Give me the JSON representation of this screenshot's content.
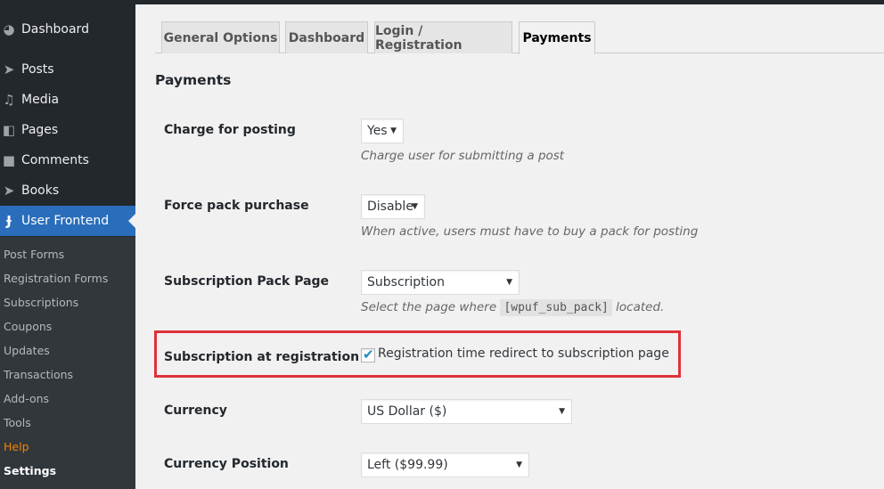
{
  "sidebar": {
    "menu": [
      {
        "label": "Dashboard",
        "icon": "dashboard-icon"
      },
      {
        "label": "Posts",
        "icon": "pin-icon"
      },
      {
        "label": "Media",
        "icon": "media-icon"
      },
      {
        "label": "Pages",
        "icon": "pages-icon"
      },
      {
        "label": "Comments",
        "icon": "comment-icon"
      },
      {
        "label": "Books",
        "icon": "pin-icon"
      },
      {
        "label": "User Frontend",
        "icon": "wpuf-logo-icon",
        "active": true
      }
    ],
    "submenu": [
      {
        "label": "Post Forms"
      },
      {
        "label": "Registration Forms"
      },
      {
        "label": "Subscriptions"
      },
      {
        "label": "Coupons"
      },
      {
        "label": "Updates"
      },
      {
        "label": "Transactions"
      },
      {
        "label": "Add-ons"
      },
      {
        "label": "Tools"
      },
      {
        "label": "Help"
      },
      {
        "label": "Settings",
        "current": true
      }
    ]
  },
  "tabs": [
    {
      "label": "General Options"
    },
    {
      "label": "Dashboard"
    },
    {
      "label": "Login / Registration"
    },
    {
      "label": "Payments",
      "active": true
    }
  ],
  "section_title": "Payments",
  "settings": {
    "charge_for_posting": {
      "label": "Charge for posting",
      "value": "Yes",
      "description": "Charge user for submitting a post"
    },
    "force_pack_purchase": {
      "label": "Force pack purchase",
      "value": "Disable",
      "description": "When active, users must have to buy a pack for posting"
    },
    "subscription_pack_page": {
      "label": "Subscription Pack Page",
      "value": "Subscription",
      "description_before": "Select the page where",
      "shortcode": "[wpuf_sub_pack]",
      "description_after": "located."
    },
    "subscription_at_registration": {
      "label": "Subscription at registration",
      "checkbox_label": "Registration time redirect to subscription page",
      "checked": true
    },
    "currency": {
      "label": "Currency",
      "value": "US Dollar ($)"
    },
    "currency_position": {
      "label": "Currency Position",
      "value": "Left ($99.99)"
    }
  },
  "colors": {
    "sidebar_bg": "#23282d",
    "submenu_bg": "#32373c",
    "active_menu": "#2a6ebb",
    "help_link": "#f18500",
    "highlight_border": "#e0303a"
  }
}
